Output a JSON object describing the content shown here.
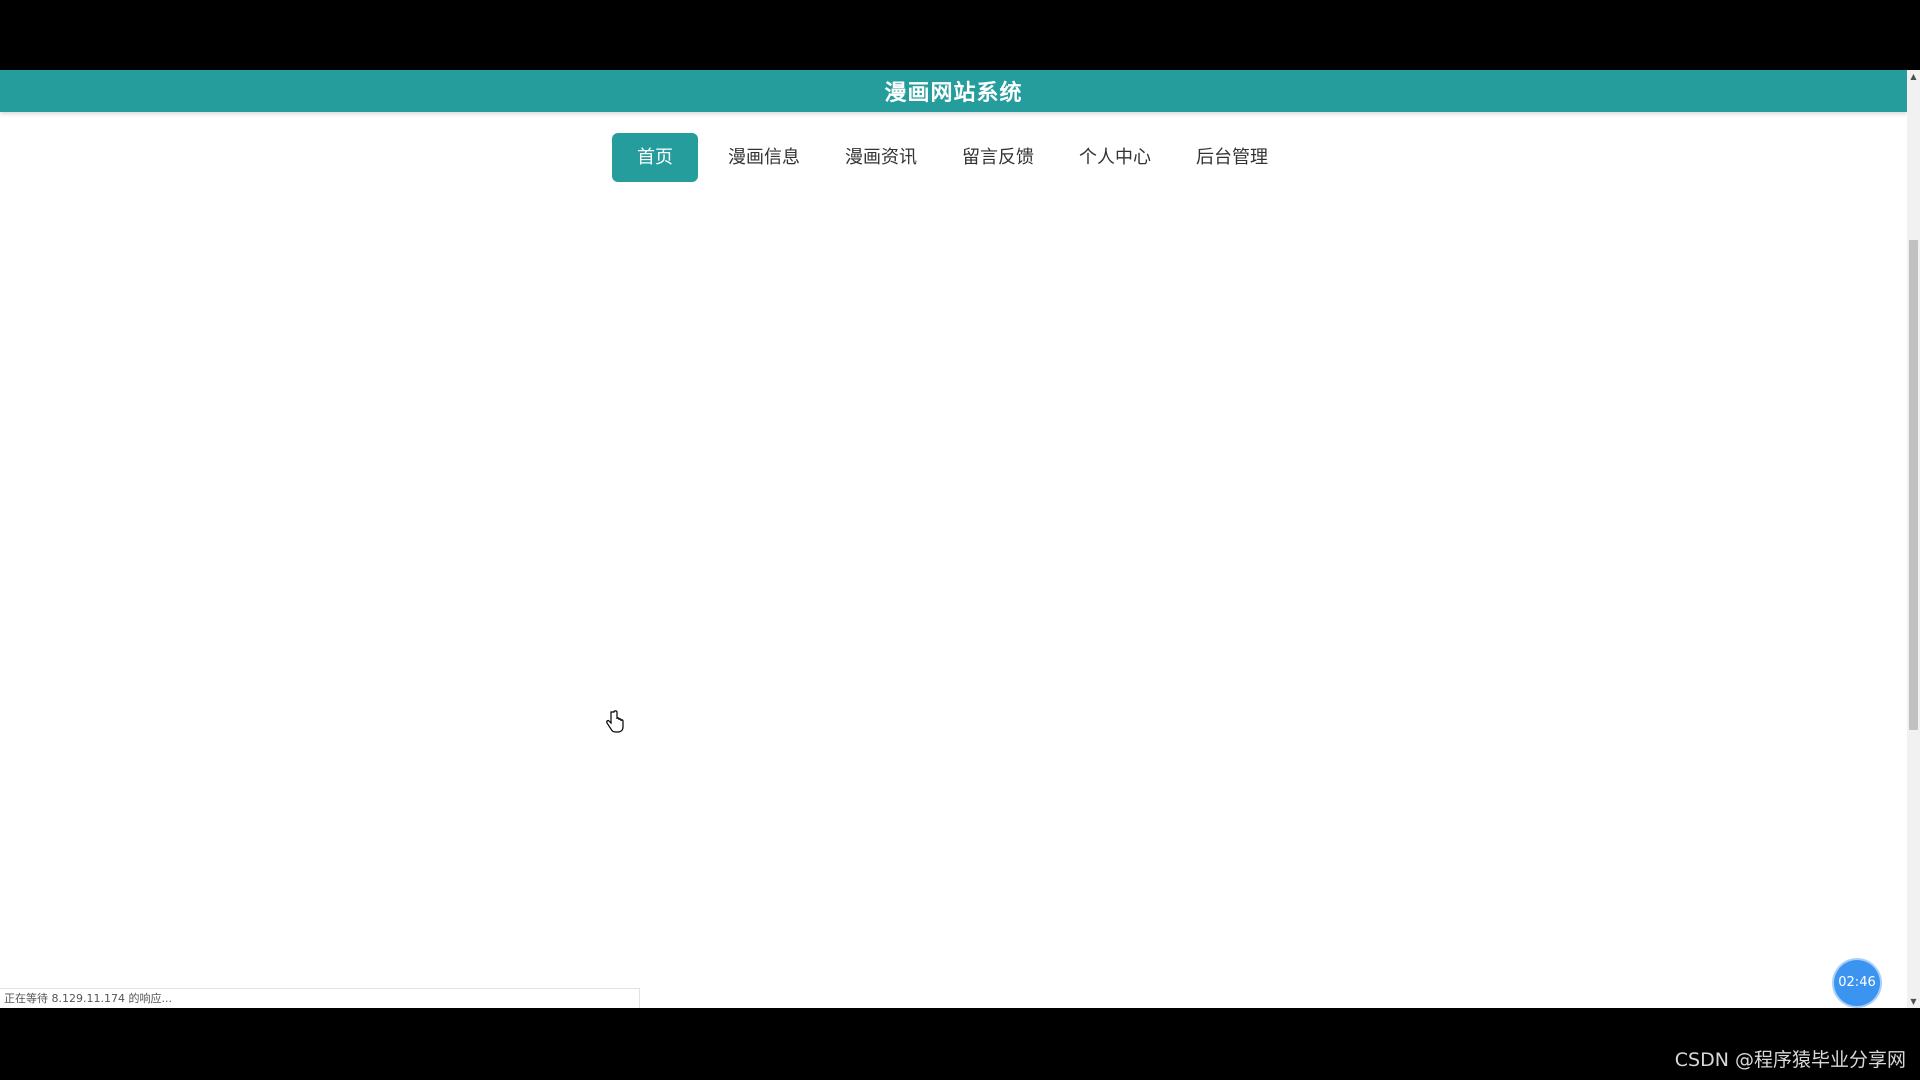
{
  "site": {
    "title": "漫画网站系统",
    "accent_color": "#259d9c"
  },
  "nav": {
    "items": [
      {
        "label": "首页",
        "active": true
      },
      {
        "label": "漫画信息",
        "active": false
      },
      {
        "label": "漫画资讯",
        "active": false
      },
      {
        "label": "留言反馈",
        "active": false
      },
      {
        "label": "个人中心",
        "active": false
      },
      {
        "label": "后台管理",
        "active": false
      }
    ]
  },
  "status_bar": {
    "text": "正在等待 8.129.11.174 的响应..."
  },
  "timer": {
    "text": "02:46"
  },
  "watermark": {
    "text": "CSDN @程序猿毕业分享网"
  },
  "icons": {
    "cursor": "hand-pointer-icon",
    "scroll_up": "triangle-up-icon",
    "scroll_down": "triangle-down-icon"
  }
}
